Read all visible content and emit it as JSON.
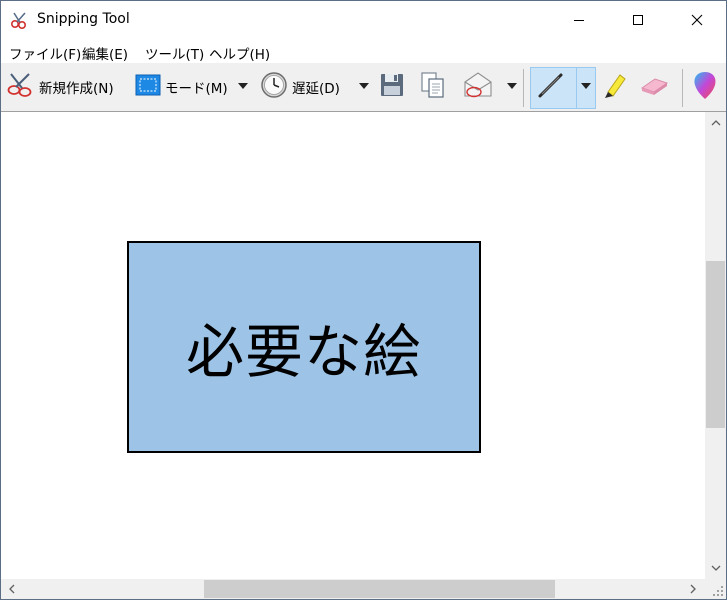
{
  "window": {
    "title": "Snipping Tool"
  },
  "menu": {
    "items": [
      {
        "label": "ファイル(F)"
      },
      {
        "label": "編集(E)"
      },
      {
        "label": "ツール(T)"
      },
      {
        "label": "ヘルプ(H)"
      }
    ]
  },
  "toolbar": {
    "new_label": "新規作成(N)",
    "mode_label": "モード(M)",
    "delay_label": "遅延(D)"
  },
  "canvas": {
    "captured_text": "必要な絵"
  },
  "colors": {
    "box_fill": "#9dc3e6",
    "pen_active_bg": "#cce4f7"
  }
}
